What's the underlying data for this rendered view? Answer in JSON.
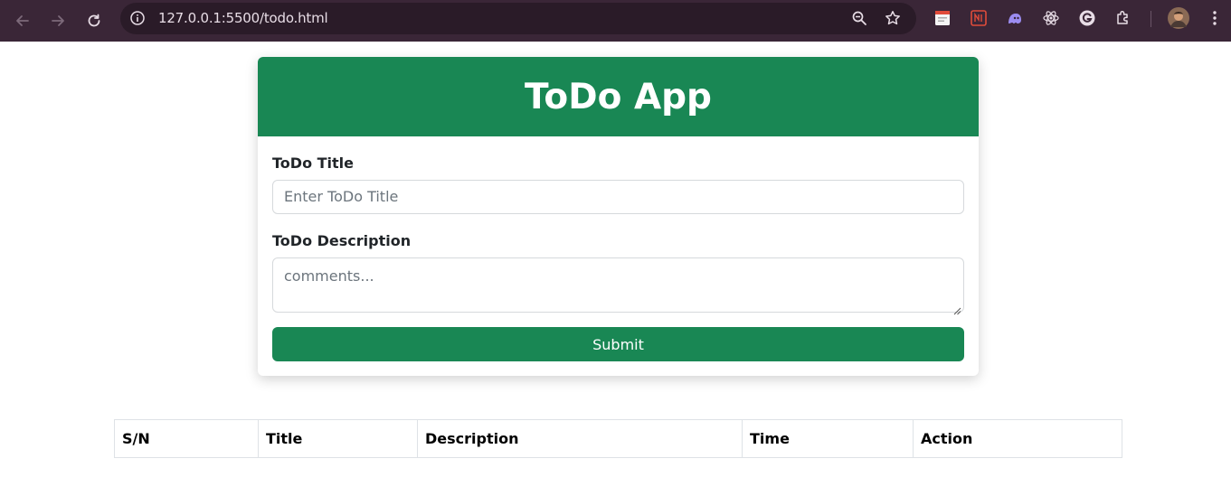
{
  "browser": {
    "url": "127.0.0.1:5500/todo.html",
    "icons": {
      "back": "back-arrow-icon",
      "forward": "forward-arrow-icon",
      "reload": "reload-icon",
      "info": "site-info-icon",
      "zoom": "zoom-icon",
      "bookmark": "star-icon",
      "extensions": "puzzle-icon",
      "menu": "kebab-menu-icon"
    }
  },
  "app": {
    "title": "ToDo App",
    "form": {
      "title_label": "ToDo Title",
      "title_placeholder": "Enter ToDo Title",
      "description_label": "ToDo Description",
      "description_placeholder": "comments...",
      "submit_label": "Submit"
    },
    "table": {
      "columns": [
        "S/N",
        "Title",
        "Description",
        "Time",
        "Action"
      ]
    }
  },
  "colors": {
    "brand": "#198754",
    "browser_frame": "#3a2637"
  }
}
